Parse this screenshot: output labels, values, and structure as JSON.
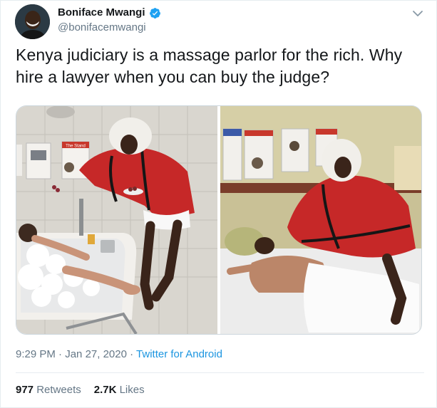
{
  "author": {
    "display_name": "Boniface Mwangi",
    "handle": "@bonifacemwangi",
    "verified": true
  },
  "tweet": {
    "text": "Kenya judiciary is a massage parlor for the rich. Why hire a lawyer when you can buy the judge?"
  },
  "media": {
    "left_newspaper_masthead": "The Stand"
  },
  "meta": {
    "time": "9:29 PM",
    "separator": "·",
    "date": "Jan 27, 2020",
    "source": "Twitter for Android"
  },
  "stats": {
    "retweets_count": "977",
    "retweets_label": "Retweets",
    "likes_count": "2.7K",
    "likes_label": "Likes"
  },
  "icons": {
    "verified": "verified-badge-icon",
    "more": "chevron-down-icon"
  },
  "colors": {
    "link": "#1b95e0",
    "verified": "#1da1f2",
    "secondary_text": "#657786"
  }
}
